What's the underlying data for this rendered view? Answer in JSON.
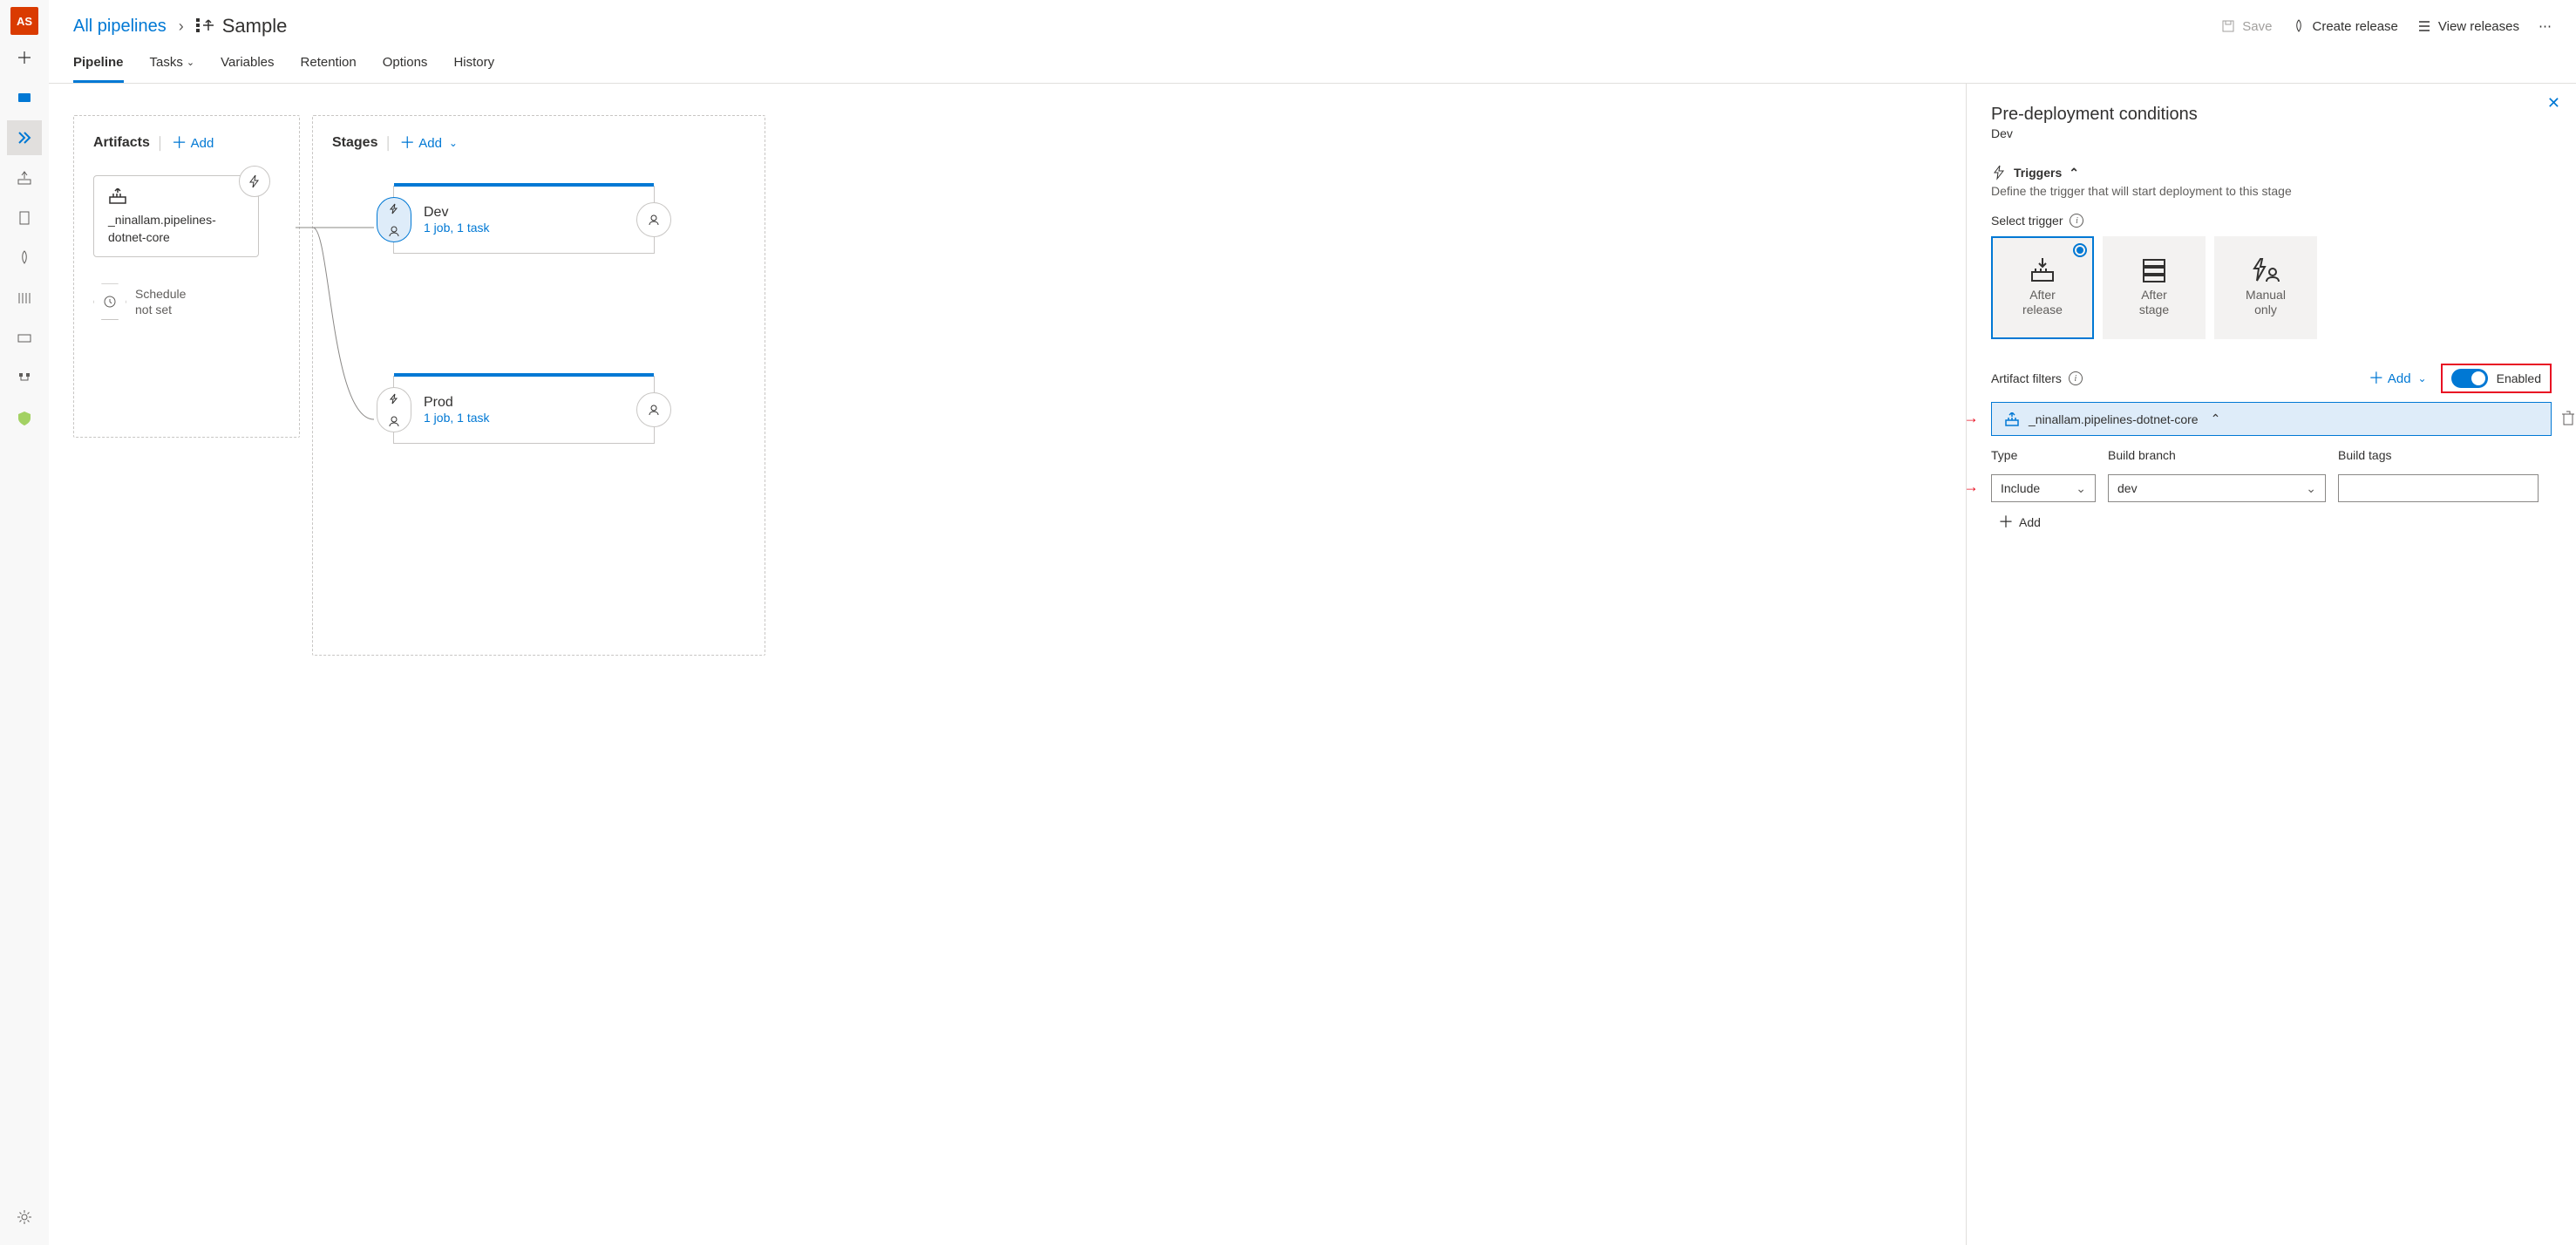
{
  "avatar": "AS",
  "breadcrumb": {
    "root": "All pipelines",
    "current": "Sample"
  },
  "topActions": {
    "save": "Save",
    "createRelease": "Create release",
    "viewReleases": "View releases"
  },
  "tabs": {
    "pipeline": "Pipeline",
    "tasks": "Tasks",
    "variables": "Variables",
    "retention": "Retention",
    "options": "Options",
    "history": "History"
  },
  "sections": {
    "artifacts": "Artifacts",
    "stages": "Stages",
    "add": "Add"
  },
  "artifact": {
    "name": "_ninallam.pipelines-dotnet-core",
    "scheduleLabel": "Schedule\nnot set"
  },
  "stages": {
    "dev": {
      "name": "Dev",
      "sub": "1 job, 1 task"
    },
    "prod": {
      "name": "Prod",
      "sub": "1 job, 1 task"
    }
  },
  "panel": {
    "title": "Pre-deployment conditions",
    "stage": "Dev",
    "triggersHead": "Triggers",
    "triggersDesc": "Define the trigger that will start deployment to this stage",
    "selectTrigger": "Select trigger",
    "triggerOptions": {
      "afterRelease": "After\nrelease",
      "afterStage": "After\nstage",
      "manualOnly": "Manual\nonly"
    },
    "artifactFilters": "Artifact filters",
    "addFilter": "Add",
    "enabled": "Enabled",
    "filterName": "_ninallam.pipelines-dotnet-core",
    "typeLabel": "Type",
    "branchLabel": "Build branch",
    "tagsLabel": "Build tags",
    "typeValue": "Include",
    "branchValue": "dev",
    "addRow": "Add"
  }
}
